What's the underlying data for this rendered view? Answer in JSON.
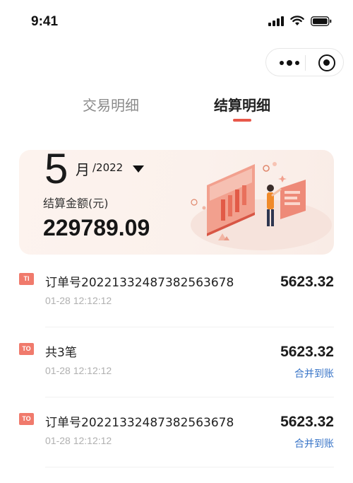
{
  "status_bar": {
    "time": "9:41"
  },
  "tabs": [
    {
      "label": "交易明细",
      "active": false
    },
    {
      "label": "结算明细",
      "active": true
    }
  ],
  "summary": {
    "month": "5",
    "month_unit": "月",
    "year": "/2022",
    "amount_label": "结算金额(元)",
    "amount": "229789.09"
  },
  "list": [
    {
      "badge": "TI",
      "title": "订单号20221332487382563678",
      "time": "01-28 12:12:12",
      "amount": "5623.32",
      "status": ""
    },
    {
      "badge": "TO",
      "title": "共3笔",
      "time": "01-28 12:12:12",
      "amount": "5623.32",
      "status": "合并到账"
    },
    {
      "badge": "TO",
      "title": "订单号20221332487382563678",
      "time": "01-28 12:12:12",
      "amount": "5623.32",
      "status": "合并到账"
    }
  ],
  "colors": {
    "accent": "#e8584a",
    "link": "#3a76c8",
    "badge": "#f07a6c"
  }
}
